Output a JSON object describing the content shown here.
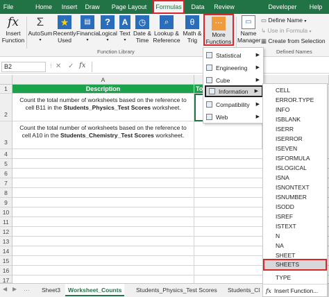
{
  "menu_tabs": [
    "File",
    "Home",
    "Insert",
    "Draw",
    "Page Layout",
    "Formulas",
    "Data",
    "Review",
    "Developer",
    "Help"
  ],
  "ribbon": {
    "insert_function": [
      "Insert",
      "Function"
    ],
    "autosum": "AutoSum",
    "recently_used": [
      "Recently",
      "Used"
    ],
    "financial": "Financial",
    "logical": "Logical",
    "text": "Text",
    "date_time": [
      "Date &",
      "Time"
    ],
    "lookup": [
      "Lookup &",
      "Reference"
    ],
    "math": [
      "Math &",
      "Trig"
    ],
    "more_functions": [
      "More",
      "Functions"
    ],
    "name_manager": [
      "Name",
      "Manager"
    ],
    "define_name": "Define Name",
    "use_in_formula": "Use in Formula",
    "create_from_selection": "Create from Selection",
    "group_function_library": "Function Library",
    "group_defined_names": "Defined Names"
  },
  "formula_bar": {
    "name_box": "B2",
    "fx": "fx"
  },
  "columns": [
    "A"
  ],
  "col_b_partial": "To",
  "rows": [
    "1",
    "2",
    "3",
    "4",
    "5",
    "6",
    "7",
    "8",
    "9",
    "10",
    "11",
    "12",
    "13",
    "14",
    "15",
    "16",
    "17"
  ],
  "cells": {
    "a1": "Description",
    "a2_pre": "Count the total number of worksheets based on the reference to cell B11 in the ",
    "a2_bold": "Students_Physics_Test Scores",
    "a2_post": " worksheet.",
    "a3_pre": "Count the total number of worksheets based on the reference to cell A10 in the ",
    "a3_bold": "Students_Chemistry_Test Scores",
    "a3_post": " worksheet."
  },
  "sheet_tabs": [
    "Sheet3",
    "Worksheet_Counts",
    "Students_Physics_Test Scores",
    "Students_Cl"
  ],
  "more_functions_menu": [
    "Statistical",
    "Engineering",
    "Cube",
    "Information",
    "Compatibility",
    "Web"
  ],
  "information_menu": [
    "CELL",
    "ERROR.TYPE",
    "INFO",
    "ISBLANK",
    "ISERR",
    "ISERROR",
    "ISEVEN",
    "ISFORMULA",
    "ISLOGICAL",
    "ISNA",
    "ISNONTEXT",
    "ISNUMBER",
    "ISODD",
    "ISREF",
    "ISTEXT",
    "N",
    "NA",
    "SHEET",
    "SHEETS",
    "TYPE"
  ],
  "insert_function_item": "Insert Function...",
  "colors": {
    "excel_green": "#217346",
    "highlight_red": "#d9262c",
    "header_fill": "#1aa34a"
  }
}
